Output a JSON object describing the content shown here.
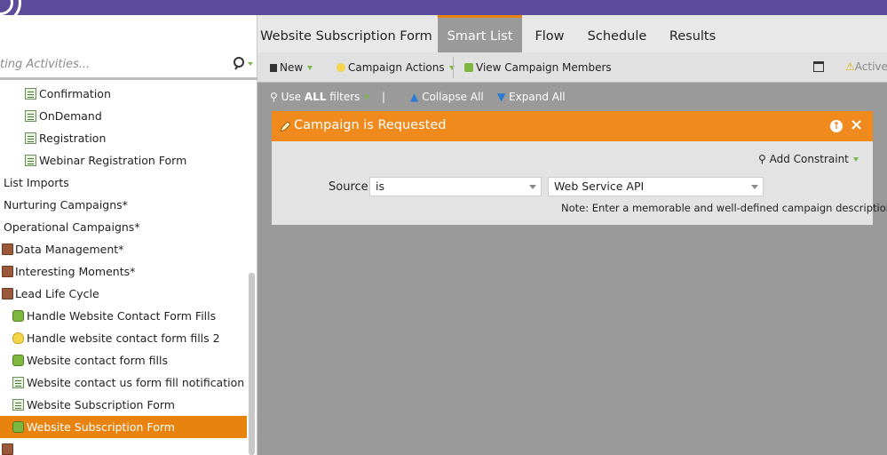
{
  "search": {
    "placeholder_text": "ting Activities..."
  },
  "tree": [
    {
      "label": "Confirmation",
      "icon": "form-icon",
      "indent": 2
    },
    {
      "label": "OnDemand",
      "icon": "form-icon",
      "indent": 2
    },
    {
      "label": "Registration",
      "icon": "form-icon",
      "indent": 2
    },
    {
      "label": "Webinar Registration Form",
      "icon": "form-icon",
      "indent": 2
    },
    {
      "label": "List Imports",
      "icon": "",
      "indent": 0
    },
    {
      "label": "Nurturing Campaigns*",
      "icon": "",
      "indent": 0
    },
    {
      "label": "Operational Campaigns*",
      "icon": "",
      "indent": 0
    },
    {
      "label": "Data Management*",
      "icon": "folder-icon",
      "indent": 0
    },
    {
      "label": "Interesting Moments*",
      "icon": "folder-icon",
      "indent": 0
    },
    {
      "label": "Lead Life Cycle",
      "icon": "folder-icon",
      "indent": 0
    },
    {
      "label": "Handle Website Contact Form Fills",
      "icon": "campaign-icon",
      "indent": 1
    },
    {
      "label": "Handle website contact form fills 2",
      "icon": "bulb-icon",
      "indent": 1
    },
    {
      "label": "Website contact form fills",
      "icon": "campaign-icon",
      "indent": 1
    },
    {
      "label": "Website contact us form fill notification",
      "icon": "email-icon",
      "indent": 1
    },
    {
      "label": "Website Subscription Form",
      "icon": "email-icon",
      "indent": 1
    },
    {
      "label": "Website Subscription Form",
      "icon": "campaign-icon",
      "indent": 1,
      "selected": true
    }
  ],
  "tabs": [
    {
      "label": "Website Subscription Form",
      "active": false
    },
    {
      "label": "Smart List",
      "active": true
    },
    {
      "label": "Flow",
      "active": false
    },
    {
      "label": "Schedule",
      "active": false
    },
    {
      "label": "Results",
      "active": false
    }
  ],
  "toolbar": {
    "new_label": "New",
    "campaign_actions_label": "Campaign Actions",
    "view_members_label": "View Campaign Members",
    "active_label": "Active"
  },
  "filterbar": {
    "use_prefix": "Use ",
    "use_bold": "ALL",
    "use_suffix": " filters",
    "separator": "|",
    "collapse_label": "Collapse All",
    "expand_label": "Expand All"
  },
  "trigger": {
    "title": "Campaign is Requested",
    "add_constraint_label": "Add Constraint",
    "source_label": "Source:",
    "operator_value": "is",
    "value": "Web Service API",
    "note": "Note: Enter a memorable and well-defined campaign description"
  },
  "colors": {
    "brand_purple": "#5a4c9a",
    "accent_orange": "#f08a1c",
    "selected_orange": "#e9830f"
  }
}
